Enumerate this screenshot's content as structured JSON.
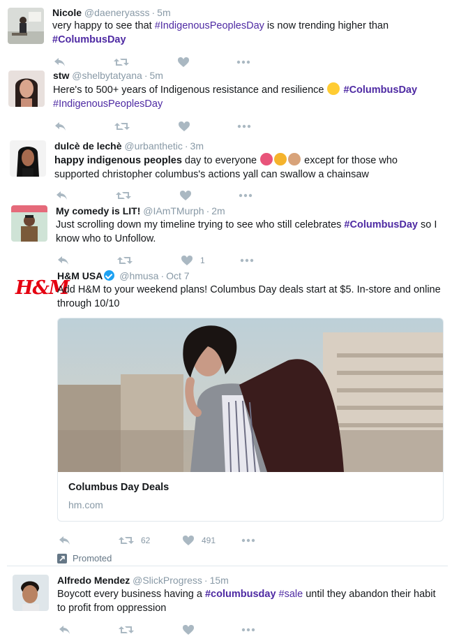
{
  "tweets": [
    {
      "name": "Nicole",
      "handle": "@daeneryasss",
      "time": "5m",
      "text": [
        {
          "t": "very happy to see that "
        },
        {
          "t": "#IndigenousPeoplesDay",
          "tag": true
        },
        {
          "t": " is now trending higher than "
        },
        {
          "t": "#ColumbusDay",
          "tag": true,
          "bold": true
        }
      ]
    },
    {
      "name": "stw",
      "handle": "@shelbytatyana",
      "time": "5m",
      "text": [
        {
          "t": "Here's to 500+ years of Indigenous resistance and resilience "
        },
        {
          "emoji": "raised-fist",
          "color": "#ffcc33"
        },
        {
          "t": " "
        },
        {
          "t": "#ColumbusDay",
          "tag": true,
          "bold": true
        },
        {
          "t": " "
        },
        {
          "t": "#IndigenousPeoplesDay",
          "tag": true
        }
      ]
    },
    {
      "name": "dulcè de lechè",
      "handle": "@urbanthetic",
      "time": "3m",
      "text": [
        {
          "t": "happy indigenous peoples",
          "bold": true
        },
        {
          "t": " day to everyone "
        },
        {
          "emoji": "heart",
          "color": "#e8547a"
        },
        {
          "emoji": "sun",
          "color": "#f5b32c"
        },
        {
          "emoji": "fist",
          "color": "#d8a37a"
        },
        {
          "t": " except for those who supported christopher columbus's actions yall can swallow a chainsaw"
        }
      ]
    },
    {
      "name": "My comedy is LIT!",
      "handle": "@IAmTMurph",
      "time": "2m",
      "like_count": "1",
      "text": [
        {
          "t": "Just scrolling down my timeline trying to see who still celebrates "
        },
        {
          "t": "#ColumbusDay",
          "tag": true,
          "bold": true
        },
        {
          "t": " so I know who to Unfollow."
        }
      ]
    },
    {
      "name": "H&M USA",
      "handle": "@hmusa",
      "time": "Oct 7",
      "verified": true,
      "logo_text": "H&M",
      "text": [
        {
          "t": "Add H&M to your weekend plans! Columbus Day deals start at $5. In-store and online through 10/10"
        }
      ],
      "card": {
        "title": "Columbus Day Deals",
        "domain": "hm.com"
      },
      "retweet_count": "62",
      "like_count": "491",
      "promoted_label": "Promoted"
    },
    {
      "name": "Alfredo Mendez",
      "handle": "@SlickProgress",
      "time": "15m",
      "text": [
        {
          "t": "Boycott every business having a "
        },
        {
          "t": "#columbusday",
          "tag": true,
          "bold": true
        },
        {
          "t": " "
        },
        {
          "t": "#sale",
          "tag": true
        },
        {
          "t": " until they abandon their habit to profit from oppression"
        }
      ]
    }
  ],
  "colors": {
    "hashtag": "#4e2aa3",
    "action_icon": "#aab8c2",
    "meta": "#8899a6",
    "hm_red": "#e50010"
  },
  "icons": [
    "reply-icon",
    "retweet-icon",
    "like-icon",
    "more-icon",
    "verified-icon",
    "promoted-icon"
  ]
}
